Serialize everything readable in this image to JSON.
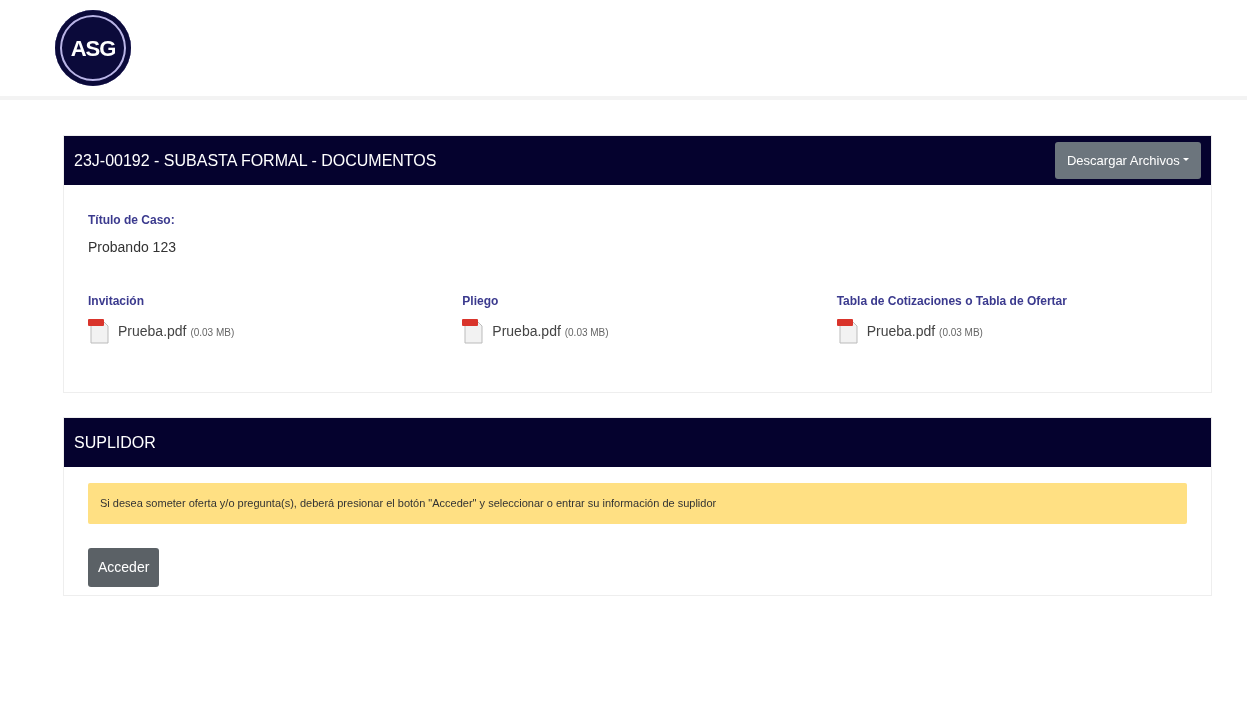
{
  "logo": {
    "text": "ASG"
  },
  "documents_panel": {
    "title": "23J-00192 - SUBASTA FORMAL - DOCUMENTOS",
    "download_button": "Descargar Archivos",
    "case_title_label": "Título de Caso:",
    "case_title": "Probando 123",
    "files": [
      {
        "label": "Invitación",
        "name": "Prueba.pdf",
        "size": "(0.03 MB)"
      },
      {
        "label": "Pliego",
        "name": "Prueba.pdf",
        "size": "(0.03 MB)"
      },
      {
        "label": "Tabla de Cotizaciones o Tabla de Ofertar",
        "name": "Prueba.pdf",
        "size": "(0.03 MB)"
      }
    ]
  },
  "supplier_panel": {
    "title": "SUPLIDOR",
    "notice": "Si desea someter oferta y/o pregunta(s), deberá presionar el botón \"Acceder\" y seleccionar o entrar su información de suplidor",
    "button": "Acceder"
  }
}
